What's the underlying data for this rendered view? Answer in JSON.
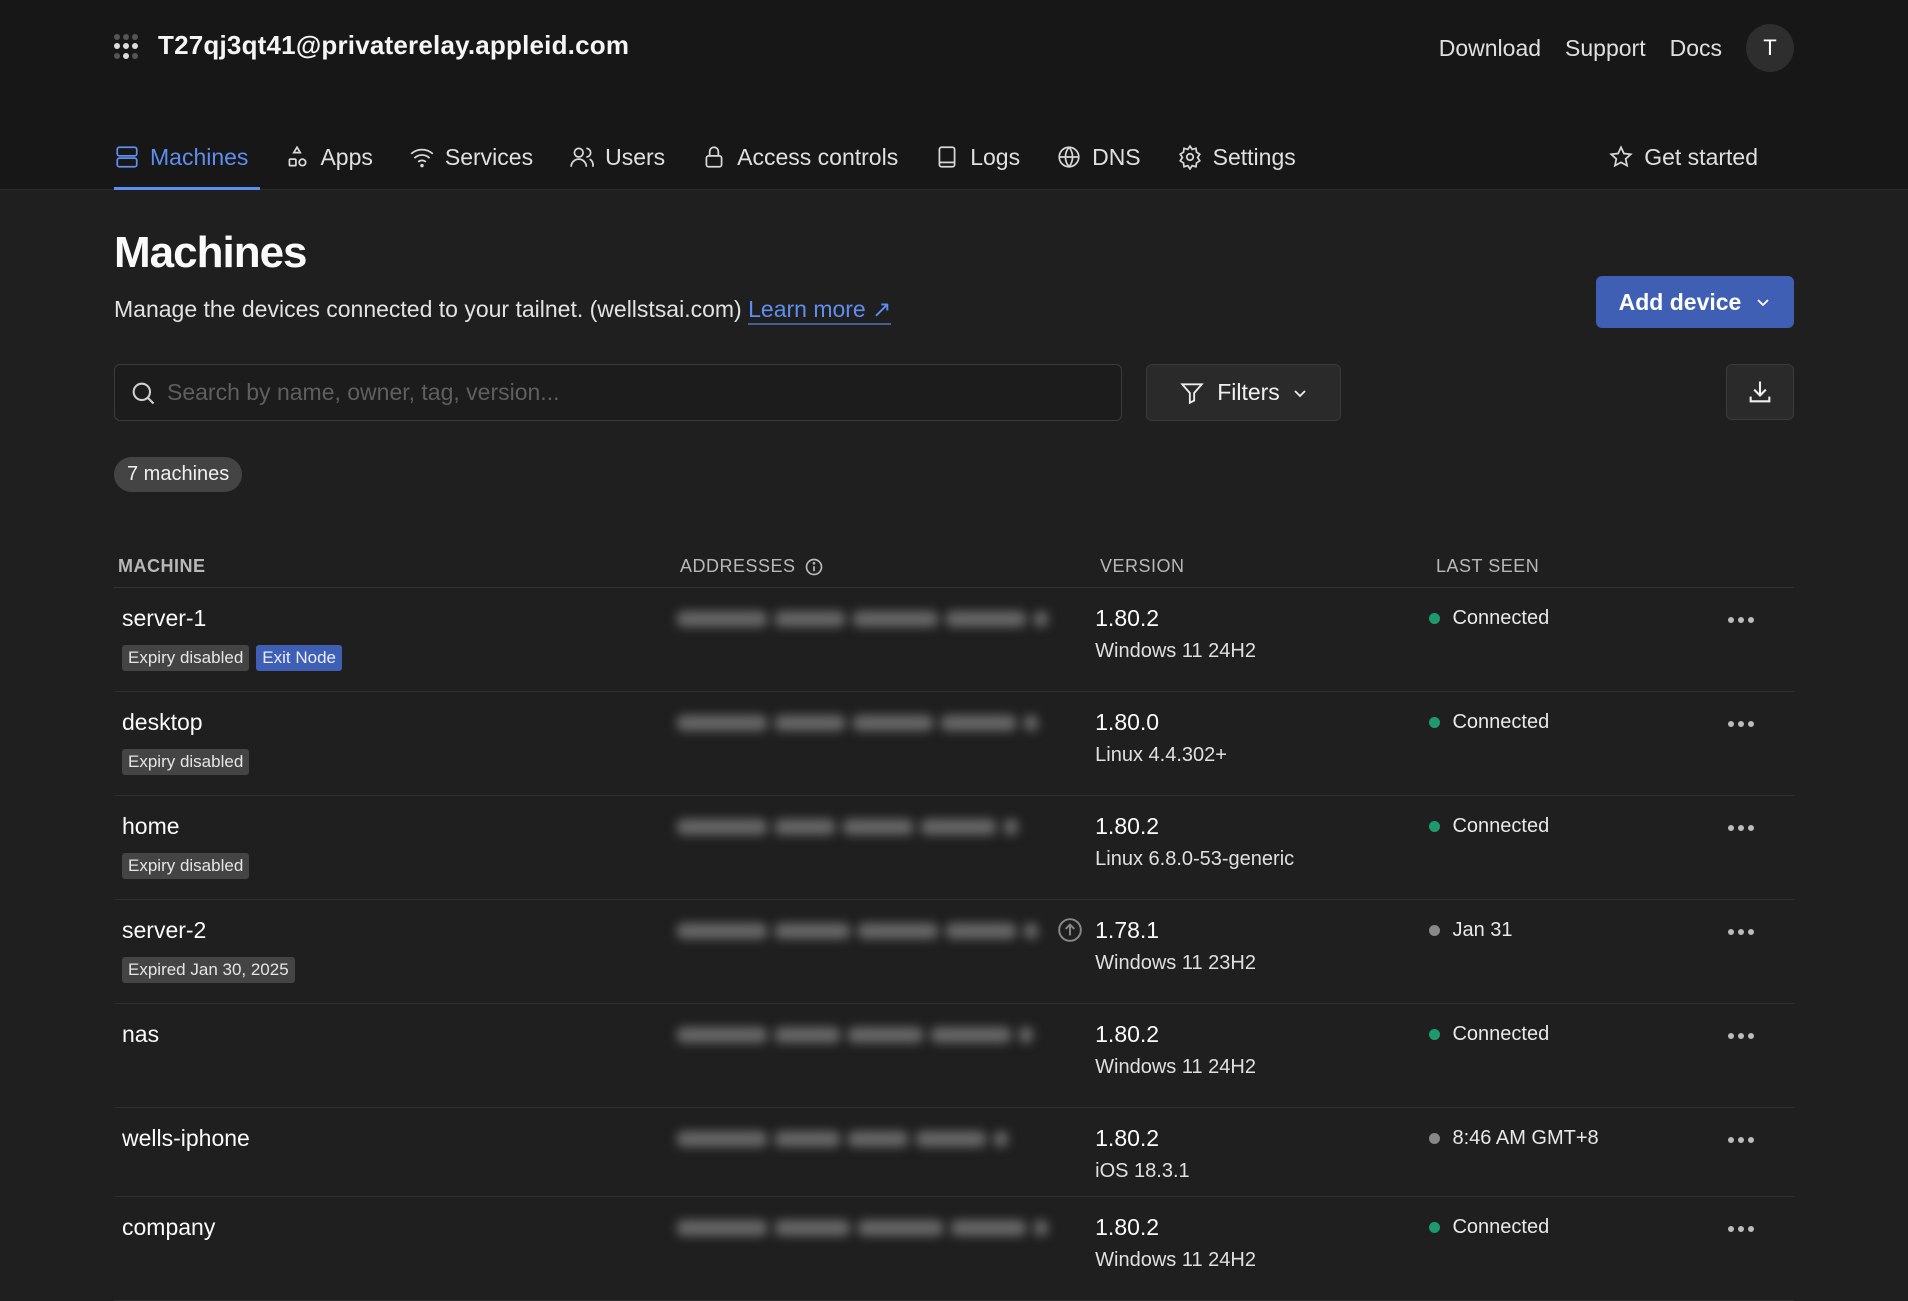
{
  "header": {
    "account": "T27qj3qt41@privaterelay.appleid.com",
    "links": [
      "Download",
      "Support",
      "Docs"
    ],
    "avatar_initial": "T"
  },
  "nav": {
    "tabs": [
      {
        "label": "Machines",
        "icon": "server-icon",
        "active": true
      },
      {
        "label": "Apps",
        "icon": "shapes-icon"
      },
      {
        "label": "Services",
        "icon": "wifi-icon"
      },
      {
        "label": "Users",
        "icon": "users-icon"
      },
      {
        "label": "Access controls",
        "icon": "lock-icon"
      },
      {
        "label": "Logs",
        "icon": "book-icon"
      },
      {
        "label": "DNS",
        "icon": "globe-icon"
      },
      {
        "label": "Settings",
        "icon": "gear-icon"
      }
    ],
    "get_started": "Get started"
  },
  "page": {
    "title": "Machines",
    "subtitle": "Manage the devices connected to your tailnet. (wellstsai.com)",
    "learn_more": "Learn more ↗",
    "add_device": "Add device",
    "search_placeholder": "Search by name, owner, tag, version...",
    "filters": "Filters",
    "count": "7 machines"
  },
  "colors": {
    "accent": "#5e8ef0",
    "primary_button": "#3f5fb5",
    "connected": "#1d9a6c",
    "offline": "#888888"
  },
  "table": {
    "headers": {
      "machine": "MACHINE",
      "addresses": "ADDRESSES",
      "version": "VERSION",
      "last_seen": "LAST SEEN"
    },
    "rows": [
      {
        "name": "server-1",
        "badges": [
          {
            "text": "Expiry disabled"
          },
          {
            "text": "Exit Node",
            "style": "blue"
          }
        ],
        "version": "1.80.2",
        "os": "Windows 11 24H2",
        "last_seen": "Connected",
        "status": "connected"
      },
      {
        "name": "desktop",
        "badges": [
          {
            "text": "Expiry disabled"
          }
        ],
        "version": "1.80.0",
        "os": "Linux 4.4.302+",
        "last_seen": "Connected",
        "status": "connected"
      },
      {
        "name": "home",
        "badges": [
          {
            "text": "Expiry disabled"
          }
        ],
        "version": "1.80.2",
        "os": "Linux 6.8.0-53-generic",
        "last_seen": "Connected",
        "status": "connected"
      },
      {
        "name": "server-2",
        "badges": [
          {
            "text": "Expired Jan 30, 2025"
          }
        ],
        "version": "1.78.1",
        "os": "Windows 11 23H2",
        "last_seen": "Jan 31",
        "status": "offline",
        "update_available": true
      },
      {
        "name": "nas",
        "badges": [],
        "version": "1.80.2",
        "os": "Windows 11 24H2",
        "last_seen": "Connected",
        "status": "connected"
      },
      {
        "name": "wells-iphone",
        "badges": [],
        "version": "1.80.2",
        "os": "iOS 18.3.1",
        "last_seen": "8:46 AM GMT+8",
        "status": "offline"
      },
      {
        "name": "company",
        "badges": [],
        "version": "1.80.2",
        "os": "Windows 11 24H2",
        "last_seen": "Connected",
        "status": "connected"
      }
    ]
  }
}
